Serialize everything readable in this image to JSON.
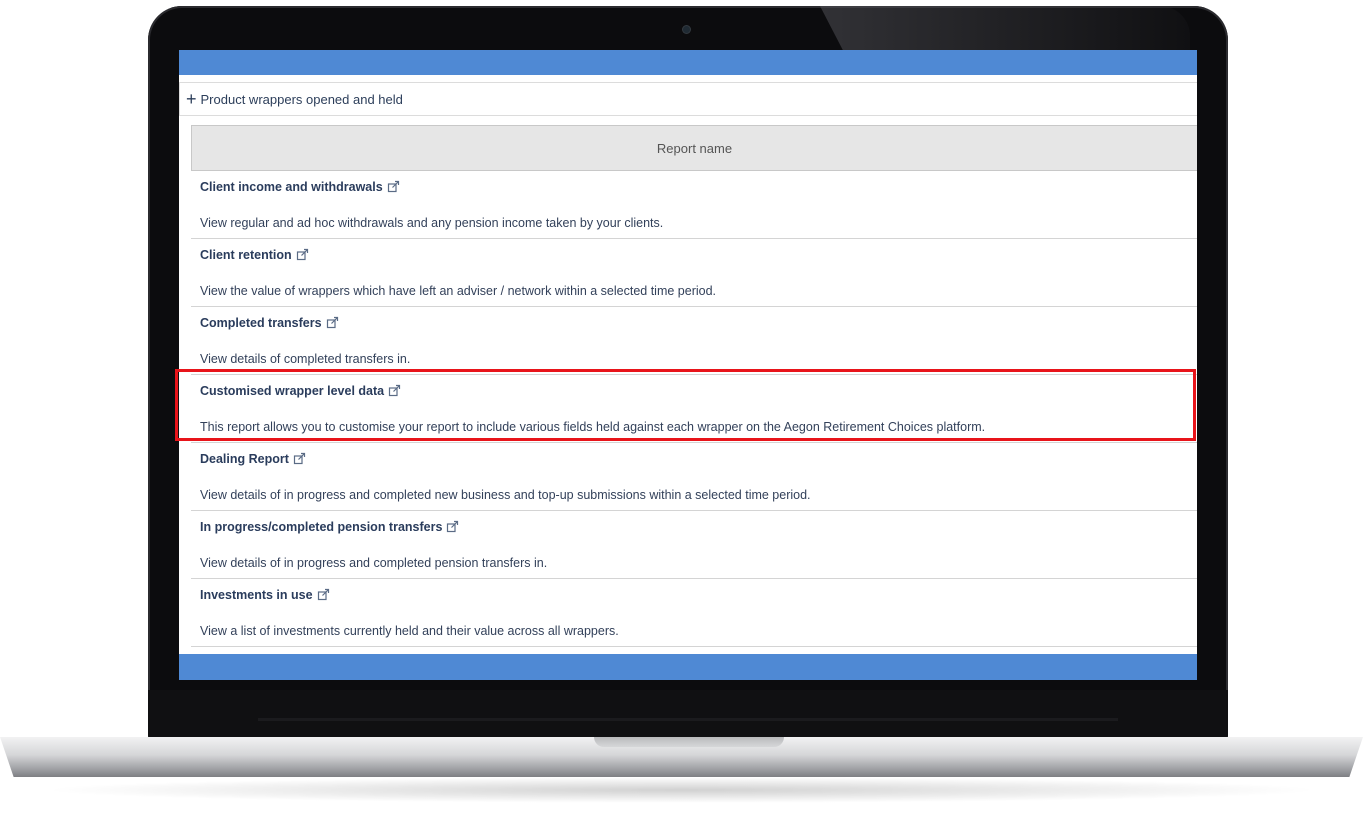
{
  "expander": {
    "icon": "plus-icon",
    "label": "Product wrappers opened and held"
  },
  "table": {
    "header": "Report name",
    "rows": [
      {
        "title": "Client income and withdrawals",
        "description": "View regular and ad hoc withdrawals and any pension income taken by your clients."
      },
      {
        "title": "Client retention",
        "description": "View the value of wrappers which have left an adviser / network within a selected time period."
      },
      {
        "title": "Completed transfers",
        "description": "View details of completed transfers in."
      },
      {
        "title": "Customised wrapper level data",
        "description": "This report allows you to customise your report to include various fields held against each wrapper on the Aegon Retirement Choices platform.",
        "highlighted": true
      },
      {
        "title": "Dealing Report",
        "description": "View details of in progress and completed new business and top-up submissions within a selected time period."
      },
      {
        "title": "In progress/completed pension transfers",
        "description": "View details of in progress and completed pension transfers in."
      },
      {
        "title": "Investments in use",
        "description": "View a list of investments currently held and their value across all wrappers."
      }
    ]
  },
  "colors": {
    "accent_bar": "#4f89d4",
    "highlight_border": "#e8141a",
    "link_text": "#2a3c5c"
  },
  "icons": {
    "row_link_icon": "external-link-icon"
  }
}
